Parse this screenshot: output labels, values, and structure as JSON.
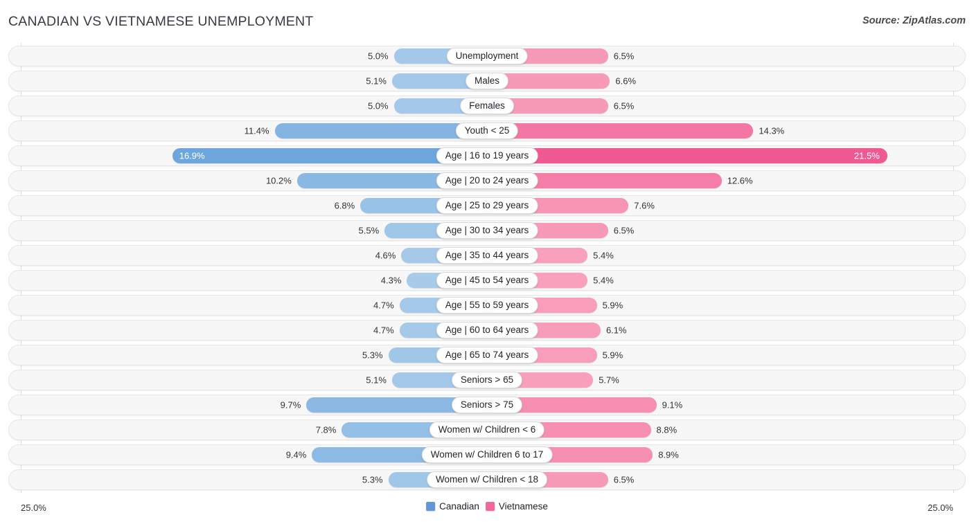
{
  "header": {
    "title": "CANADIAN VS VIETNAMESE UNEMPLOYMENT",
    "source": "Source: ZipAtlas.com"
  },
  "axis": {
    "left_label": "25.0%",
    "right_label": "25.0%",
    "max": 25.0
  },
  "legend": [
    {
      "label": "Canadian",
      "color": "#6197d6"
    },
    {
      "label": "Vietnamese",
      "color": "#f2669b"
    }
  ],
  "colors": {
    "canadian_light": "#a8cbea",
    "canadian_dark": "#5b9bd9",
    "vietnamese_light": "#f9a8c0",
    "vietnamese_dark": "#f05a93",
    "row_track": "#f7f7f7",
    "gridline": "#dcdcdc",
    "text": "#333333"
  },
  "chart_data": {
    "type": "bar",
    "title": "CANADIAN VS VIETNAMESE UNEMPLOYMENT",
    "subtitle": "",
    "xlabel": "",
    "ylabel": "",
    "orientation": "horizontal-diverging",
    "xlim": [
      -25.0,
      25.0
    ],
    "grid": true,
    "legend_position": "bottom-center",
    "categories": [
      "Unemployment",
      "Males",
      "Females",
      "Youth < 25",
      "Age | 16 to 19 years",
      "Age | 20 to 24 years",
      "Age | 25 to 29 years",
      "Age | 30 to 34 years",
      "Age | 35 to 44 years",
      "Age | 45 to 54 years",
      "Age | 55 to 59 years",
      "Age | 60 to 64 years",
      "Age | 65 to 74 years",
      "Seniors > 65",
      "Seniors > 75",
      "Women w/ Children < 6",
      "Women w/ Children 6 to 17",
      "Women w/ Children < 18"
    ],
    "series": [
      {
        "name": "Canadian",
        "side": "left",
        "values": [
          5.0,
          5.1,
          5.0,
          11.4,
          16.9,
          10.2,
          6.8,
          5.5,
          4.6,
          4.3,
          4.7,
          4.7,
          5.3,
          5.1,
          9.7,
          7.8,
          9.4,
          5.3
        ],
        "labels": [
          "5.0%",
          "5.1%",
          "5.0%",
          "11.4%",
          "16.9%",
          "10.2%",
          "6.8%",
          "5.5%",
          "4.6%",
          "4.3%",
          "4.7%",
          "4.7%",
          "5.3%",
          "5.1%",
          "9.7%",
          "7.8%",
          "9.4%",
          "5.3%"
        ]
      },
      {
        "name": "Vietnamese",
        "side": "right",
        "values": [
          6.5,
          6.6,
          6.5,
          14.3,
          21.5,
          12.6,
          7.6,
          6.5,
          5.4,
          5.4,
          5.9,
          6.1,
          5.9,
          5.7,
          9.1,
          8.8,
          8.9,
          6.5
        ],
        "labels": [
          "6.5%",
          "6.6%",
          "6.5%",
          "14.3%",
          "21.5%",
          "12.6%",
          "7.6%",
          "6.5%",
          "5.4%",
          "5.4%",
          "5.9%",
          "6.1%",
          "5.9%",
          "5.7%",
          "9.1%",
          "8.8%",
          "8.9%",
          "6.5%"
        ]
      }
    ],
    "rows": [
      {
        "label": "Unemployment",
        "left": 5.0,
        "left_label": "5.0%",
        "right": 6.5,
        "right_label": "6.5%",
        "label_inside": false
      },
      {
        "label": "Males",
        "left": 5.1,
        "left_label": "5.1%",
        "right": 6.6,
        "right_label": "6.6%",
        "label_inside": false
      },
      {
        "label": "Females",
        "left": 5.0,
        "left_label": "5.0%",
        "right": 6.5,
        "right_label": "6.5%",
        "label_inside": false
      },
      {
        "label": "Youth < 25",
        "left": 11.4,
        "left_label": "11.4%",
        "right": 14.3,
        "right_label": "14.3%",
        "label_inside": false
      },
      {
        "label": "Age | 16 to 19 years",
        "left": 16.9,
        "left_label": "16.9%",
        "right": 21.5,
        "right_label": "21.5%",
        "label_inside": true
      },
      {
        "label": "Age | 20 to 24 years",
        "left": 10.2,
        "left_label": "10.2%",
        "right": 12.6,
        "right_label": "12.6%",
        "label_inside": false
      },
      {
        "label": "Age | 25 to 29 years",
        "left": 6.8,
        "left_label": "6.8%",
        "right": 7.6,
        "right_label": "7.6%",
        "label_inside": false
      },
      {
        "label": "Age | 30 to 34 years",
        "left": 5.5,
        "left_label": "5.5%",
        "right": 6.5,
        "right_label": "6.5%",
        "label_inside": false
      },
      {
        "label": "Age | 35 to 44 years",
        "left": 4.6,
        "left_label": "4.6%",
        "right": 5.4,
        "right_label": "5.4%",
        "label_inside": false
      },
      {
        "label": "Age | 45 to 54 years",
        "left": 4.3,
        "left_label": "4.3%",
        "right": 5.4,
        "right_label": "5.4%",
        "label_inside": false
      },
      {
        "label": "Age | 55 to 59 years",
        "left": 4.7,
        "left_label": "4.7%",
        "right": 5.9,
        "right_label": "5.9%",
        "label_inside": false
      },
      {
        "label": "Age | 60 to 64 years",
        "left": 4.7,
        "left_label": "4.7%",
        "right": 6.1,
        "right_label": "6.1%",
        "label_inside": false
      },
      {
        "label": "Age | 65 to 74 years",
        "left": 5.3,
        "left_label": "5.3%",
        "right": 5.9,
        "right_label": "5.9%",
        "label_inside": false
      },
      {
        "label": "Seniors > 65",
        "left": 5.1,
        "left_label": "5.1%",
        "right": 5.7,
        "right_label": "5.7%",
        "label_inside": false
      },
      {
        "label": "Seniors > 75",
        "left": 9.7,
        "left_label": "9.7%",
        "right": 9.1,
        "right_label": "9.1%",
        "label_inside": false
      },
      {
        "label": "Women w/ Children < 6",
        "left": 7.8,
        "left_label": "7.8%",
        "right": 8.8,
        "right_label": "8.8%",
        "label_inside": false
      },
      {
        "label": "Women w/ Children 6 to 17",
        "left": 9.4,
        "left_label": "9.4%",
        "right": 8.9,
        "right_label": "8.9%",
        "label_inside": false
      },
      {
        "label": "Women w/ Children < 18",
        "left": 5.3,
        "left_label": "5.3%",
        "right": 6.5,
        "right_label": "6.5%",
        "label_inside": false
      }
    ]
  }
}
